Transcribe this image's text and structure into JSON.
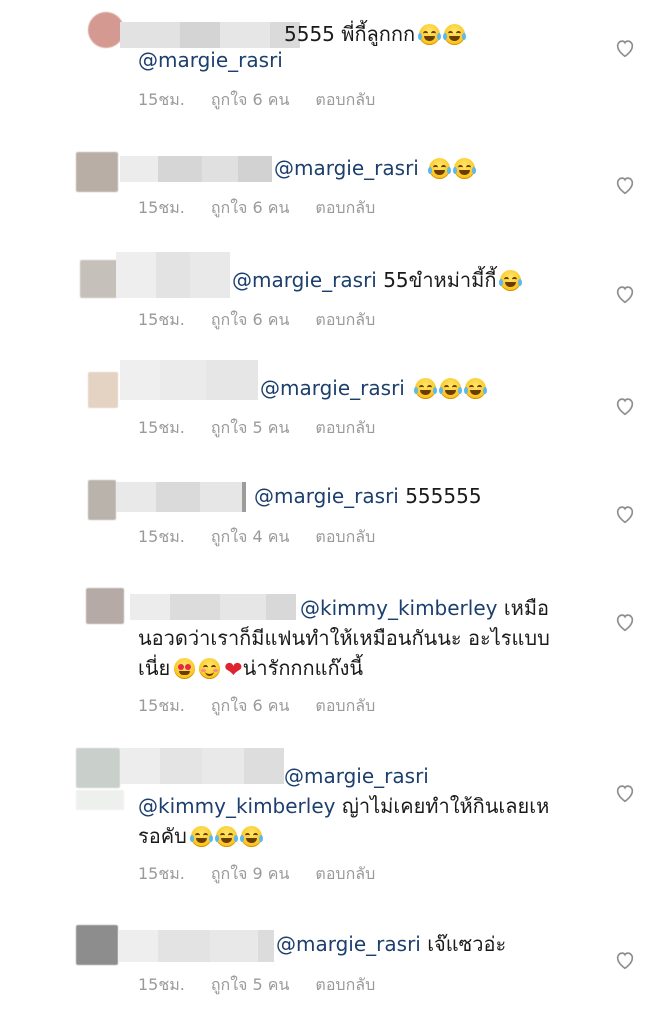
{
  "comments": [
    {
      "username": "",
      "text_first": "5555 พี่กี้ลูกกก",
      "mention": "@margie_rasri",
      "time": "15ชม.",
      "likes": "ถูกใจ 6 คน",
      "reply": "ตอบกลับ",
      "emojis": [
        "face-with-tears-of-joy",
        "face-with-tears-of-joy"
      ]
    },
    {
      "mention": "@margie_rasri",
      "text": "",
      "time": "15ชม.",
      "likes": "ถูกใจ 6 คน",
      "reply": "ตอบกลับ",
      "emojis": [
        "face-with-tears-of-joy",
        "face-with-tears-of-joy"
      ]
    },
    {
      "mention": "@margie_rasri",
      "text": "55ขำหม่ามี้กี้",
      "time": "15ชม.",
      "likes": "ถูกใจ 6 คน",
      "reply": "ตอบกลับ",
      "emojis": [
        "face-with-tears-of-joy"
      ]
    },
    {
      "mention": "@margie_rasri",
      "text": "",
      "time": "15ชม.",
      "likes": "ถูกใจ 5 คน",
      "reply": "ตอบกลับ",
      "emojis": [
        "face-with-tears-of-joy",
        "face-with-tears-of-joy",
        "face-with-tears-of-joy"
      ]
    },
    {
      "mention": "@margie_rasri",
      "text": "555555",
      "time": "15ชม.",
      "likes": "ถูกใจ 4 คน",
      "reply": "ตอบกลับ",
      "emojis": []
    },
    {
      "mention": "@kimmy_kimberley",
      "text_line1": "เหมือ",
      "text_line2": "นอวดว่าเราก็มีแฟนทำให้เหมือนกันนะ อะไรแบบ",
      "text_line3_a": "เนี่ย",
      "text_line3_b": "น่ารักกกแก๊งนี้",
      "time": "15ชม.",
      "likes": "ถูกใจ 6 คน",
      "reply": "ตอบกลับ",
      "emojis": [
        "smiling-face-with-heart-eyes",
        "smiling-face",
        "red-heart"
      ]
    },
    {
      "mention": "@margie_rasri",
      "mention2": "@kimmy_kimberley",
      "text_line2": "ญ่าไม่เคยทำให้กินเลยเห",
      "text_line3": "รอคับ",
      "time": "15ชม.",
      "likes": "ถูกใจ 9 คน",
      "reply": "ตอบกลับ",
      "emojis": [
        "face-with-tears-of-joy",
        "face-with-tears-of-joy",
        "face-with-tears-of-joy"
      ]
    },
    {
      "mention": "@margie_rasri",
      "text": "เจ๊แซวอ่ะ",
      "time": "15ชม.",
      "likes": "ถูกใจ 5 คน",
      "reply": "ตอบกลับ",
      "emojis": []
    }
  ],
  "icons": {
    "like": "heart-outline-icon"
  },
  "colors": {
    "mention": "#1c3f6e",
    "meta": "#9a9a9a",
    "heart": "#e0242f"
  }
}
